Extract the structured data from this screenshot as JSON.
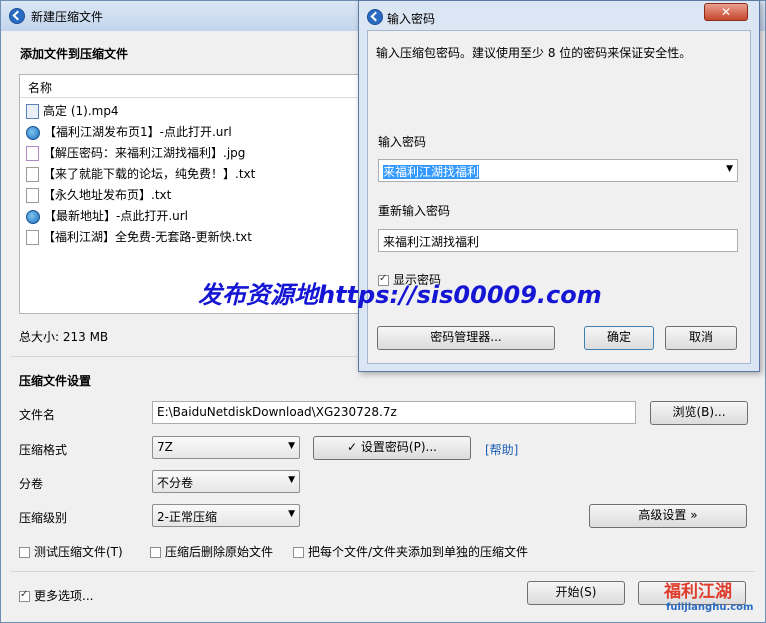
{
  "main": {
    "title": "新建压缩文件",
    "add_files_header": "添加文件到压缩文件",
    "list_header": "名称",
    "files": [
      {
        "name": "高定 (1).mp4",
        "icon": "video-file-icon"
      },
      {
        "name": "【福利江湖发布页1】-点此打开.url",
        "icon": "globe-icon"
      },
      {
        "name": "【解压密码：来福利江湖找福利】.jpg",
        "icon": "image-file-icon"
      },
      {
        "name": "【来了就能下载的论坛，纯免费！】.txt",
        "icon": "text-file-icon"
      },
      {
        "name": "【永久地址发布页】.txt",
        "icon": "text-file-icon"
      },
      {
        "name": "【最新地址】-点此打开.url",
        "icon": "globe-icon"
      },
      {
        "name": "【福利江湖】全免费-无套路-更新快.txt",
        "icon": "text-file-icon"
      }
    ],
    "total_size": "总大小: 213 MB",
    "settings_header": "压缩文件设置",
    "filename_label": "文件名",
    "filename_value": "E:\\BaiduNetdiskDownload\\XG230728.7z",
    "browse_button": "浏览(B)...",
    "format_label": "压缩格式",
    "format_value": "7Z",
    "set_password_button": "✓ 设置密码(P)...",
    "help_link": "[帮助]",
    "volume_label": "分卷",
    "volume_value": "不分卷",
    "level_label": "压缩级别",
    "level_value": "2-正常压缩",
    "advanced_button": "高级设置 »",
    "opt_test": "测试压缩文件(T)",
    "opt_delete": "压缩后删除原始文件",
    "opt_separate": "把每个文件/文件夹添加到单独的压缩文件",
    "more_options": "更多选项...",
    "start_button": "开始(S)",
    "more_options_checked": true
  },
  "dialog": {
    "title": "输入密码",
    "hint": "输入压缩包密码。建议使用至少 8 位的密码来保证安全性。",
    "pwd_label": "输入密码",
    "pwd_value": "来福利江湖找福利",
    "repeat_label": "重新输入密码",
    "repeat_value": "来福利江湖找福利",
    "show_pwd": "显示密码",
    "show_pwd_checked": true,
    "manager_button": "密码管理器...",
    "ok_button": "确定",
    "cancel_button": "取消",
    "close_glyph": "✕"
  },
  "overlays": {
    "watermark": "发布资源地https://sis00009.com",
    "logo_text": "福利江湖",
    "logo_url": "fulijianghu.com"
  },
  "colors": {
    "accent": "#2a6cc4",
    "selection": "#3399ff",
    "watermark": "#1515d4"
  }
}
